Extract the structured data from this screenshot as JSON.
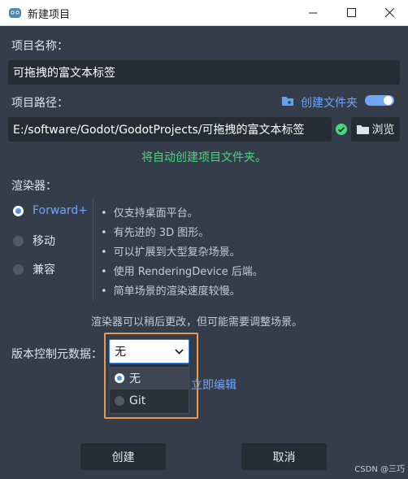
{
  "window": {
    "title": "新建项目"
  },
  "project_name": {
    "label": "项目名称：",
    "value": "可拖拽的富文本标签"
  },
  "project_path": {
    "label": "项目路径：",
    "create_folder_label": "创建文件夹",
    "create_folder_enabled": true,
    "value": "E:/software/Godot/GodotProjects/可拖拽的富文本标签",
    "browse_label": "浏览",
    "status_text": "将自动创建项目文件夹。",
    "status_color": "#45d97b"
  },
  "renderer": {
    "label": "渲染器：",
    "options": [
      "Forward+",
      "移动",
      "兼容"
    ],
    "selected": "Forward+",
    "features": [
      "仅支持桌面平台。",
      "有先进的 3D 图形。",
      "可以扩展到大型复杂场景。",
      "使用 RenderingDevice 后端。",
      "简单场景的渲染速度较慢。"
    ],
    "note": "渲染器可以稍后更改，但可能需要调整场景。"
  },
  "vcs": {
    "label": "版本控制元数据：",
    "selected": "无",
    "options": [
      "无",
      "Git"
    ],
    "partial_link": "立即编辑"
  },
  "buttons": {
    "create": "创建",
    "cancel": "取消"
  },
  "watermark": "CSDN @三巧",
  "colors": {
    "accent": "#4c94f0",
    "highlight_border": "#e89a52",
    "background": "#363d4a"
  }
}
